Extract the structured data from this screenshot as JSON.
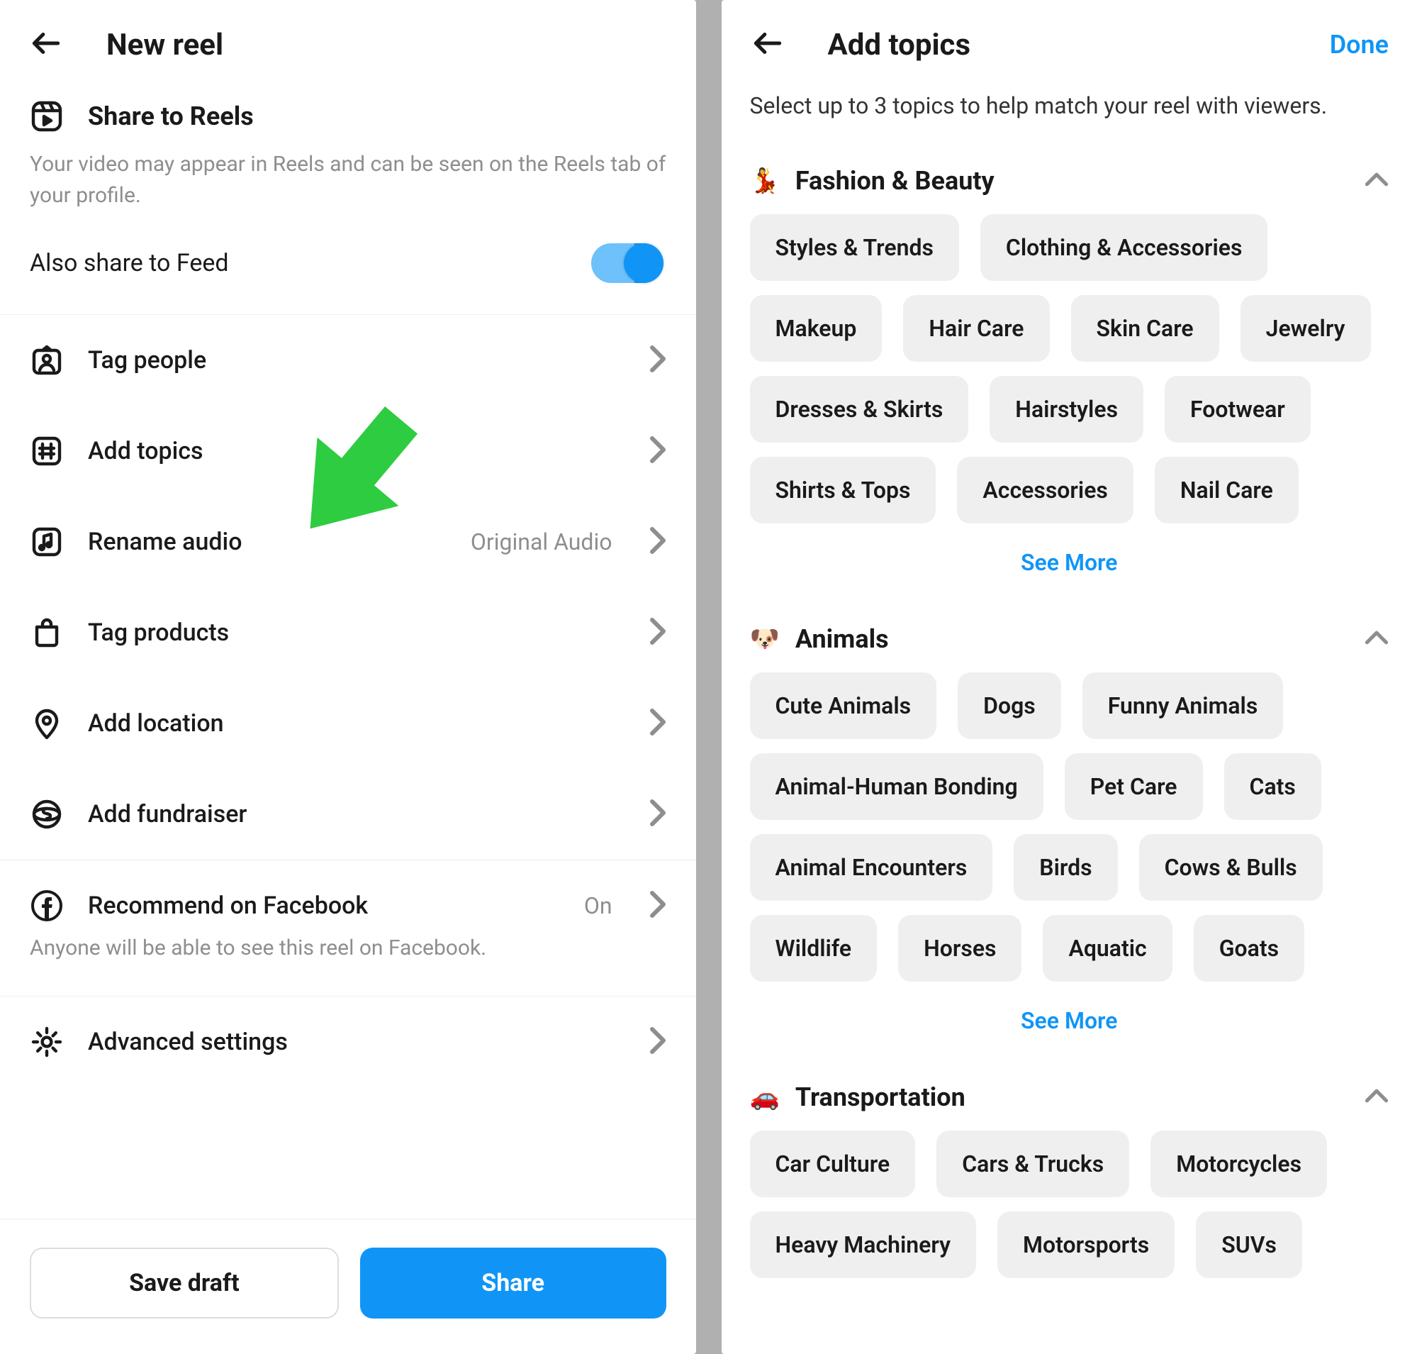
{
  "left": {
    "title": "New reel",
    "share_to_reels": "Share to Reels",
    "share_subtext": "Your video may appear in Reels and can be seen on the Reels tab of your profile.",
    "also_share_feed": "Also share to Feed",
    "rows": {
      "tag_people": "Tag people",
      "add_topics": "Add topics",
      "rename_audio": "Rename audio",
      "rename_audio_value": "Original Audio",
      "tag_products": "Tag products",
      "add_location": "Add location",
      "add_fundraiser": "Add fundraiser",
      "recommend_fb": "Recommend on Facebook",
      "recommend_fb_value": "On",
      "recommend_fb_sub": "Anyone will be able to see this reel on Facebook.",
      "advanced_settings": "Advanced settings"
    },
    "save_draft": "Save draft",
    "share": "Share"
  },
  "right": {
    "title": "Add topics",
    "done": "Done",
    "instructions": "Select up to 3 topics to help match your reel with viewers.",
    "see_more": "See More",
    "categories": [
      {
        "emoji": "💃",
        "name": "Fashion & Beauty",
        "chips": [
          "Styles & Trends",
          "Clothing & Accessories",
          "Makeup",
          "Hair Care",
          "Skin Care",
          "Jewelry",
          "Dresses & Skirts",
          "Hairstyles",
          "Footwear",
          "Shirts & Tops",
          "Accessories",
          "Nail Care"
        ],
        "see_more": true
      },
      {
        "emoji": "🐶",
        "name": "Animals",
        "chips": [
          "Cute Animals",
          "Dogs",
          "Funny Animals",
          "Animal-Human Bonding",
          "Pet Care",
          "Cats",
          "Animal Encounters",
          "Birds",
          "Cows & Bulls",
          "Wildlife",
          "Horses",
          "Aquatic",
          "Goats"
        ],
        "see_more": true
      },
      {
        "emoji": "🚗",
        "name": "Transportation",
        "chips": [
          "Car Culture",
          "Cars & Trucks",
          "Motorcycles",
          "Heavy Machinery",
          "Motorsports",
          "SUVs"
        ],
        "see_more": false
      }
    ]
  }
}
